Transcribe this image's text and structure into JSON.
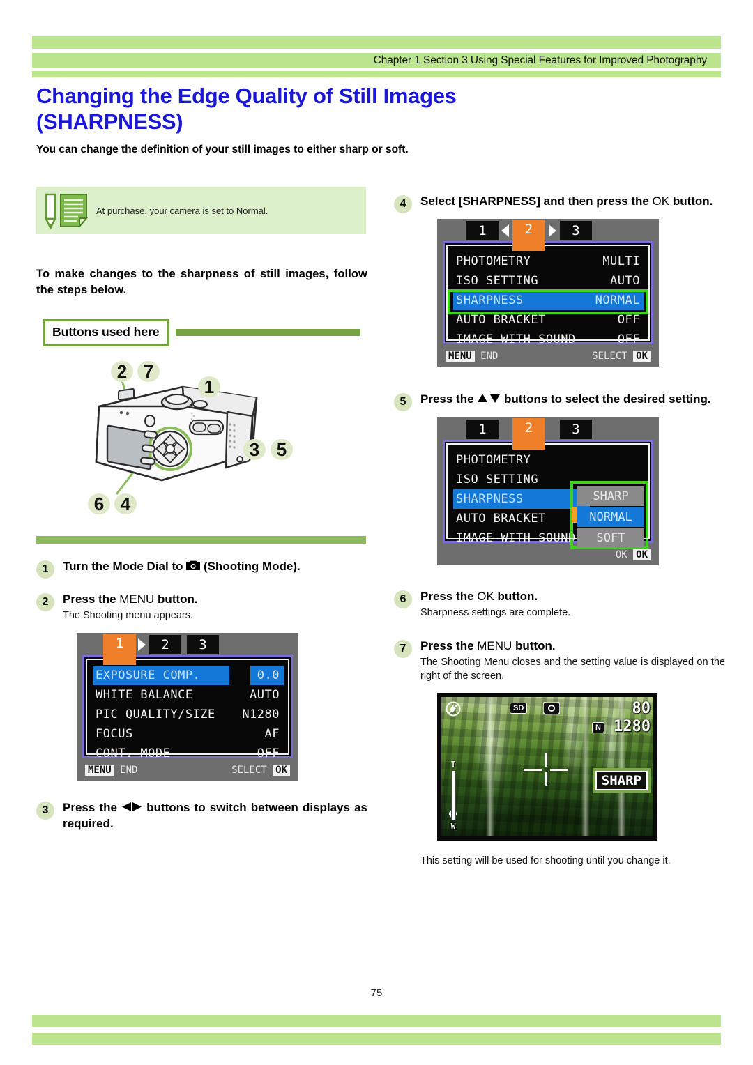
{
  "header": {
    "breadcrumb": "Chapter 1 Section 3 Using Special Features for Improved Photography"
  },
  "title": {
    "line1": "Changing the Edge Quality of Still Images",
    "line2": "(SHARPNESS)"
  },
  "subtitle": "You can change the definition of your still images to either sharp or soft.",
  "note": {
    "text": "At purchase, your camera is set to Normal.",
    "icon": "memo-pencil-icon"
  },
  "intro": "To make changes to the sharpness of still images, follow the steps below.",
  "buttons_used": {
    "label": "Buttons used here"
  },
  "camera_figure": {
    "callouts": [
      "2",
      "7",
      "1",
      "3",
      "5",
      "6",
      "4"
    ]
  },
  "steps": [
    {
      "num": "1",
      "title_pre": "Turn the Mode Dial to ",
      "icon": "camera-icon",
      "title_post": " (Shooting Mode)."
    },
    {
      "num": "2",
      "title_pre": "Press the ",
      "kw": "MENU",
      "title_post": " button.",
      "sub": "The Shooting menu appears."
    },
    {
      "num": "3",
      "title_pre": "Press the ",
      "icon": "left-right-arrows-icon",
      "title_post": " buttons to switch between displays as required."
    },
    {
      "num": "4",
      "title_pre": "Select  [SHARPNESS] and then press the ",
      "kw": "OK",
      "title_post": " button."
    },
    {
      "num": "5",
      "title_pre": "Press   the ",
      "icon": "up-down-arrows-icon",
      "title_post": " buttons to select the desired setting."
    },
    {
      "num": "6",
      "title_pre": "Press the ",
      "kw": "OK",
      "title_post": " button.",
      "sub": "Sharpness settings are complete."
    },
    {
      "num": "7",
      "title_pre": "Press the ",
      "kw": "MENU",
      "title_post": " button.",
      "sub": "The Shooting Menu closes and the setting value is displayed on the right of the screen."
    }
  ],
  "lcd_menu_1": {
    "tabs": [
      "1",
      "2",
      "3"
    ],
    "selected_tab": "1",
    "rows": [
      {
        "label": "EXPOSURE COMP.",
        "value": "0.0",
        "highlighted": true
      },
      {
        "label": "WHITE BALANCE",
        "value": "AUTO",
        "highlighted": false
      },
      {
        "label": "PIC QUALITY/SIZE",
        "value": "N1280",
        "highlighted": false
      },
      {
        "label": "FOCUS",
        "value": "AF",
        "highlighted": false
      },
      {
        "label": "CONT. MODE",
        "value": "OFF",
        "highlighted": false
      }
    ],
    "footer_left_key": "MENU",
    "footer_left_text": "END",
    "footer_right_text": "SELECT",
    "footer_right_key": "OK"
  },
  "lcd_menu_2": {
    "tabs": [
      "1",
      "2",
      "3"
    ],
    "selected_tab": "2",
    "rows": [
      {
        "label": "PHOTOMETRY",
        "value": "MULTI",
        "highlighted": false
      },
      {
        "label": "ISO SETTING",
        "value": "AUTO",
        "highlighted": false
      },
      {
        "label": "SHARPNESS",
        "value": "NORMAL",
        "highlighted": true
      },
      {
        "label": "AUTO BRACKET",
        "value": "OFF",
        "highlighted": false
      },
      {
        "label": "IMAGE WITH SOUND",
        "value": "OFF",
        "highlighted": false
      }
    ],
    "footer_left_key": "MENU",
    "footer_left_text": "END",
    "footer_right_text": "SELECT",
    "footer_right_key": "OK"
  },
  "lcd_menu_3": {
    "tabs": [
      "1",
      "2",
      "3"
    ],
    "selected_tab": "2",
    "rows": [
      {
        "label": "PHOTOMETRY",
        "value": "",
        "highlighted": false
      },
      {
        "label": "ISO SETTING",
        "value": "",
        "highlighted": false
      },
      {
        "label": "SHARPNESS",
        "value": "",
        "highlighted": true
      },
      {
        "label": "AUTO BRACKET",
        "value": "",
        "highlighted": false
      },
      {
        "label": "IMAGE WITH SOUND",
        "value": "",
        "highlighted": false
      }
    ],
    "popup_options": [
      "SHARP",
      "NORMAL",
      "SOFT"
    ],
    "popup_selected": "NORMAL",
    "footer_right_text": "OK",
    "footer_right_key": "OK"
  },
  "preview": {
    "flash_icon": "flash-off-icon",
    "card_icon": "SD",
    "mode_icon": "camera-icon",
    "shots_remaining": "80",
    "quality_icon": "N",
    "image_size": "1280",
    "zoom_tele": "T",
    "zoom_wide": "W",
    "setting_badge": "SHARP"
  },
  "closing_note": "This setting will be used for shooting until you change it.",
  "page_number": "75",
  "colors": {
    "light_green": "#bde58f",
    "note_green": "#ddf0cc",
    "mid_green": "#77a344",
    "rule_green": "#8bb95c",
    "title_blue": "#1a17d6",
    "tab_orange": "#ef7f28",
    "highlight_blue": "#1478d8",
    "callout_green": "#3fd21a",
    "badge_green": "#7aa84a"
  }
}
